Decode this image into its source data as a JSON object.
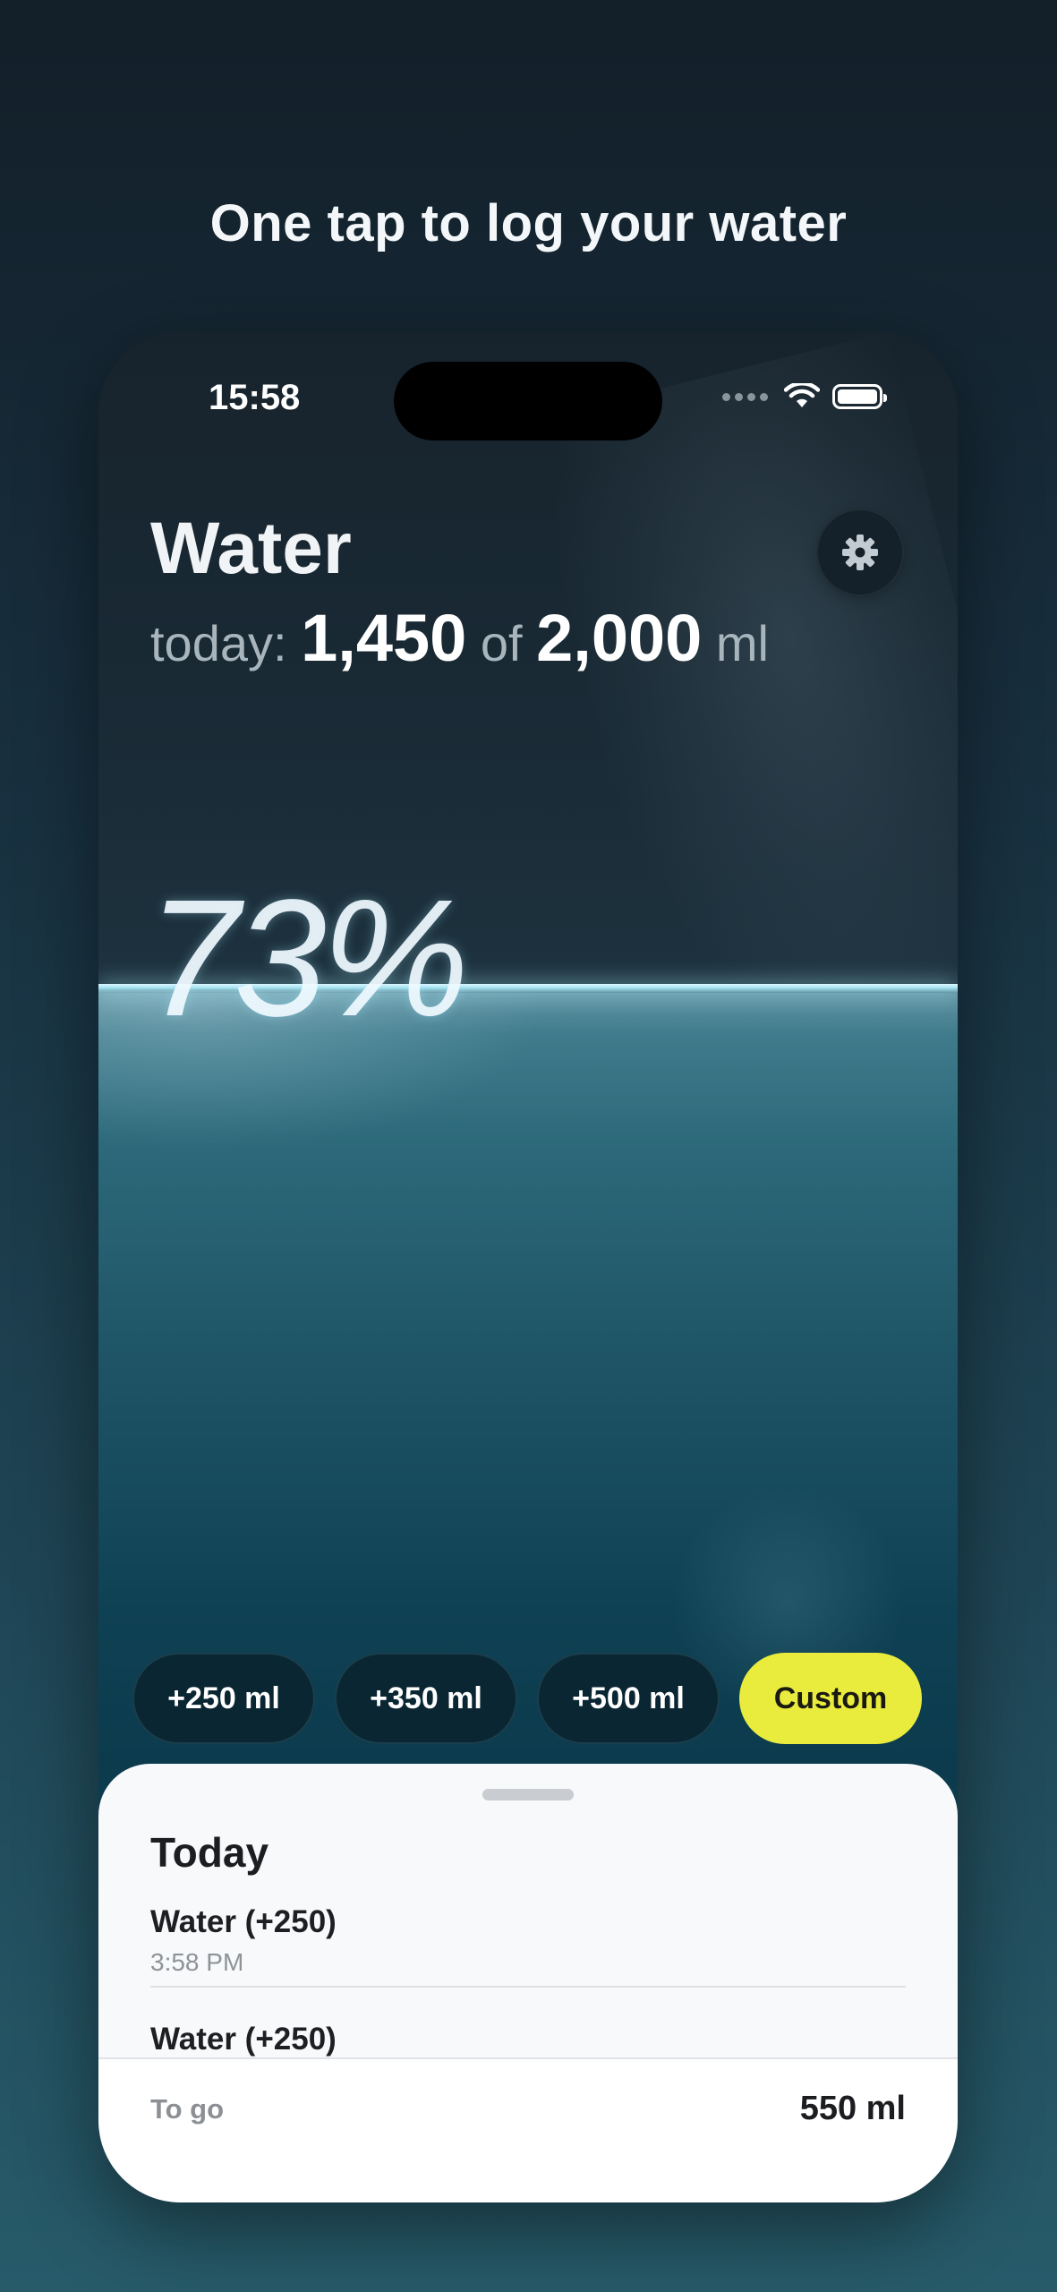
{
  "headline": "One tap to log your water",
  "status_bar": {
    "time": "15:58"
  },
  "header": {
    "title": "Water",
    "today_prefix": "today:",
    "consumed": "1,450",
    "of": "of",
    "goal": "2,000",
    "unit": "ml"
  },
  "progress": {
    "label": "73%",
    "fraction": 0.73
  },
  "quick_add": [
    {
      "label": "+250 ml"
    },
    {
      "label": "+350 ml"
    },
    {
      "label": "+500 ml"
    },
    {
      "label": "Custom"
    }
  ],
  "log_sheet": {
    "title": "Today",
    "entries": [
      {
        "name": "Water (+250)",
        "time": "3:58 PM"
      },
      {
        "name": "Water (+250)"
      }
    ],
    "togo_label": "To go",
    "togo_value": "550 ml"
  },
  "colors": {
    "accent": "#e9ec3c",
    "water": "#1e5466",
    "background": "#18303f"
  },
  "icons": {
    "settings": "gear-icon",
    "wifi": "wifi-icon",
    "battery": "battery-icon",
    "signal": "signal-icon"
  }
}
